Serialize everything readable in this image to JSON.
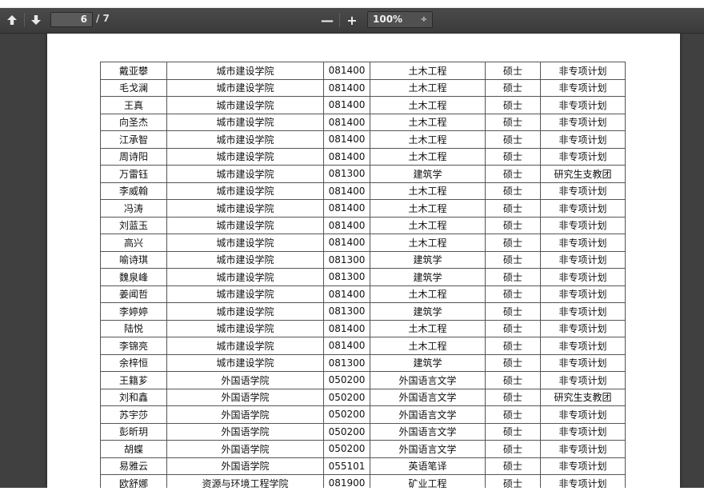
{
  "toolbar": {
    "prev_page_icon": "arrow-up",
    "next_page_icon": "arrow-down",
    "current_page": "6",
    "page_count": "/ 7",
    "zoom_out": "—",
    "zoom_in": "+",
    "zoom_level": "100%",
    "zoom_caret": "÷"
  },
  "table": {
    "rows": [
      [
        "戴亚攀",
        "城市建设学院",
        "081400",
        "土木工程",
        "硕士",
        "非专项计划"
      ],
      [
        "毛戈澜",
        "城市建设学院",
        "081400",
        "土木工程",
        "硕士",
        "非专项计划"
      ],
      [
        "王真",
        "城市建设学院",
        "081400",
        "土木工程",
        "硕士",
        "非专项计划"
      ],
      [
        "向圣杰",
        "城市建设学院",
        "081400",
        "土木工程",
        "硕士",
        "非专项计划"
      ],
      [
        "江承智",
        "城市建设学院",
        "081400",
        "土木工程",
        "硕士",
        "非专项计划"
      ],
      [
        "周诗阳",
        "城市建设学院",
        "081400",
        "土木工程",
        "硕士",
        "非专项计划"
      ],
      [
        "万雷钰",
        "城市建设学院",
        "081300",
        "建筑学",
        "硕士",
        "研究生支教团"
      ],
      [
        "李威翰",
        "城市建设学院",
        "081400",
        "土木工程",
        "硕士",
        "非专项计划"
      ],
      [
        "冯涛",
        "城市建设学院",
        "081400",
        "土木工程",
        "硕士",
        "非专项计划"
      ],
      [
        "刘蓝玉",
        "城市建设学院",
        "081400",
        "土木工程",
        "硕士",
        "非专项计划"
      ],
      [
        "高兴",
        "城市建设学院",
        "081400",
        "土木工程",
        "硕士",
        "非专项计划"
      ],
      [
        "喻诗琪",
        "城市建设学院",
        "081300",
        "建筑学",
        "硕士",
        "非专项计划"
      ],
      [
        "魏泉峰",
        "城市建设学院",
        "081300",
        "建筑学",
        "硕士",
        "非专项计划"
      ],
      [
        "姜闻哲",
        "城市建设学院",
        "081400",
        "土木工程",
        "硕士",
        "非专项计划"
      ],
      [
        "李婷婷",
        "城市建设学院",
        "081300",
        "建筑学",
        "硕士",
        "非专项计划"
      ],
      [
        "陆悦",
        "城市建设学院",
        "081400",
        "土木工程",
        "硕士",
        "非专项计划"
      ],
      [
        "李锦亮",
        "城市建设学院",
        "081400",
        "土木工程",
        "硕士",
        "非专项计划"
      ],
      [
        "余梓恒",
        "城市建设学院",
        "081300",
        "建筑学",
        "硕士",
        "非专项计划"
      ],
      [
        "王籍芗",
        "外国语学院",
        "050200",
        "外国语言文学",
        "硕士",
        "非专项计划"
      ],
      [
        "刘和鑫",
        "外国语学院",
        "050200",
        "外国语言文学",
        "硕士",
        "研究生支教团"
      ],
      [
        "苏宇莎",
        "外国语学院",
        "050200",
        "外国语言文学",
        "硕士",
        "非专项计划"
      ],
      [
        "彭昕玥",
        "外国语学院",
        "050200",
        "外国语言文学",
        "硕士",
        "非专项计划"
      ],
      [
        "胡蝶",
        "外国语学院",
        "050200",
        "外国语言文学",
        "硕士",
        "非专项计划"
      ],
      [
        "易雅云",
        "外国语学院",
        "055101",
        "英语笔译",
        "硕士",
        "非专项计划"
      ],
      [
        "欧舒娜",
        "资源与环境工程学院",
        "081900",
        "矿业工程",
        "硕士",
        "非专项计划"
      ]
    ]
  }
}
